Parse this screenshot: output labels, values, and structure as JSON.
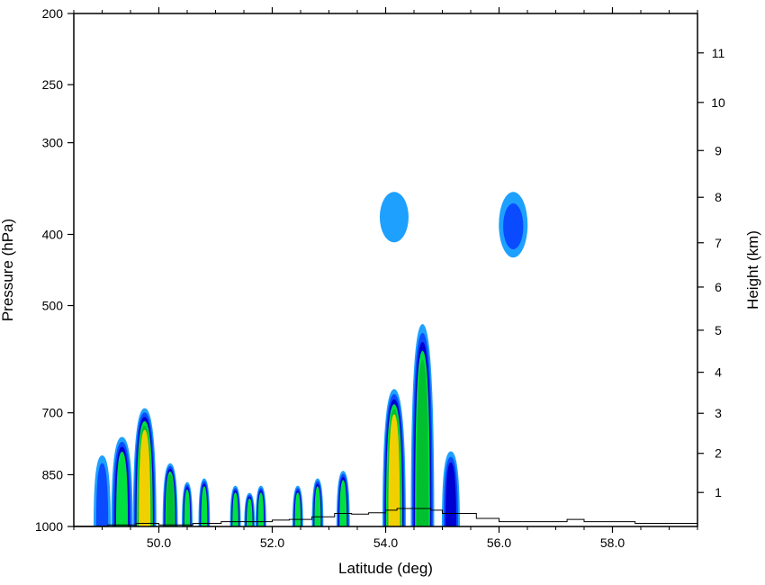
{
  "chart_data": {
    "type": "contour",
    "title": "",
    "xlabel": "Latitude (deg)",
    "ylabel": "Pressure (hPa)",
    "ylabel_right": "Height (km)",
    "xlim": [
      48.5,
      59.5
    ],
    "ylim": [
      1000,
      200
    ],
    "y_scale": "log",
    "x_ticks": [
      50.0,
      52.0,
      54.0,
      56.0,
      58.0
    ],
    "x_tick_labels": [
      "50.0",
      "52.0",
      "54.0",
      "56.0",
      "58.0"
    ],
    "y_ticks": [
      200,
      250,
      300,
      400,
      500,
      700,
      850,
      1000
    ],
    "y_tick_labels": [
      "200",
      "250",
      "300",
      "400",
      "500",
      "700",
      "850",
      "1000"
    ],
    "y_right_ticks": [
      1,
      2,
      3,
      4,
      5,
      6,
      7,
      8,
      9,
      10,
      11
    ],
    "y_right_tick_labels": [
      "1",
      "2",
      "3",
      "4",
      "5",
      "6",
      "7",
      "8",
      "9",
      "10",
      "11"
    ],
    "grid": false,
    "colors": {
      "level1": "#1ea0ff",
      "level2": "#0a4bff",
      "level3": "#0000d0",
      "level4": "#00e040",
      "level5": "#00c030",
      "level6": "#f0d000",
      "terrain": "#000000"
    },
    "cloud_features": [
      {
        "lat": 49.0,
        "p_top": 800,
        "p_bottom": 1000,
        "peak": 2
      },
      {
        "lat": 49.35,
        "p_top": 755,
        "p_bottom": 1000,
        "peak": 4
      },
      {
        "lat": 49.75,
        "p_top": 690,
        "p_bottom": 1000,
        "peak": 6
      },
      {
        "lat": 50.2,
        "p_top": 820,
        "p_bottom": 1000,
        "peak": 5
      },
      {
        "lat": 50.5,
        "p_top": 870,
        "p_bottom": 1000,
        "peak": 4
      },
      {
        "lat": 50.8,
        "p_top": 860,
        "p_bottom": 1000,
        "peak": 4
      },
      {
        "lat": 51.35,
        "p_top": 880,
        "p_bottom": 1000,
        "peak": 4
      },
      {
        "lat": 51.6,
        "p_top": 900,
        "p_bottom": 1000,
        "peak": 4
      },
      {
        "lat": 51.8,
        "p_top": 880,
        "p_bottom": 1000,
        "peak": 4
      },
      {
        "lat": 52.45,
        "p_top": 880,
        "p_bottom": 1000,
        "peak": 4
      },
      {
        "lat": 52.8,
        "p_top": 860,
        "p_bottom": 1000,
        "peak": 4
      },
      {
        "lat": 53.25,
        "p_top": 840,
        "p_bottom": 1000,
        "peak": 4
      },
      {
        "lat": 54.15,
        "p_top": 650,
        "p_bottom": 1000,
        "peak": 6
      },
      {
        "lat": 54.65,
        "p_top": 530,
        "p_bottom": 1000,
        "peak": 5
      },
      {
        "lat": 55.15,
        "p_top": 790,
        "p_bottom": 1000,
        "peak": 3
      },
      {
        "lat": 54.15,
        "p_top": 350,
        "p_bottom": 410,
        "peak": 1
      },
      {
        "lat": 56.25,
        "p_top": 350,
        "p_bottom": 430,
        "peak": 2
      }
    ]
  }
}
